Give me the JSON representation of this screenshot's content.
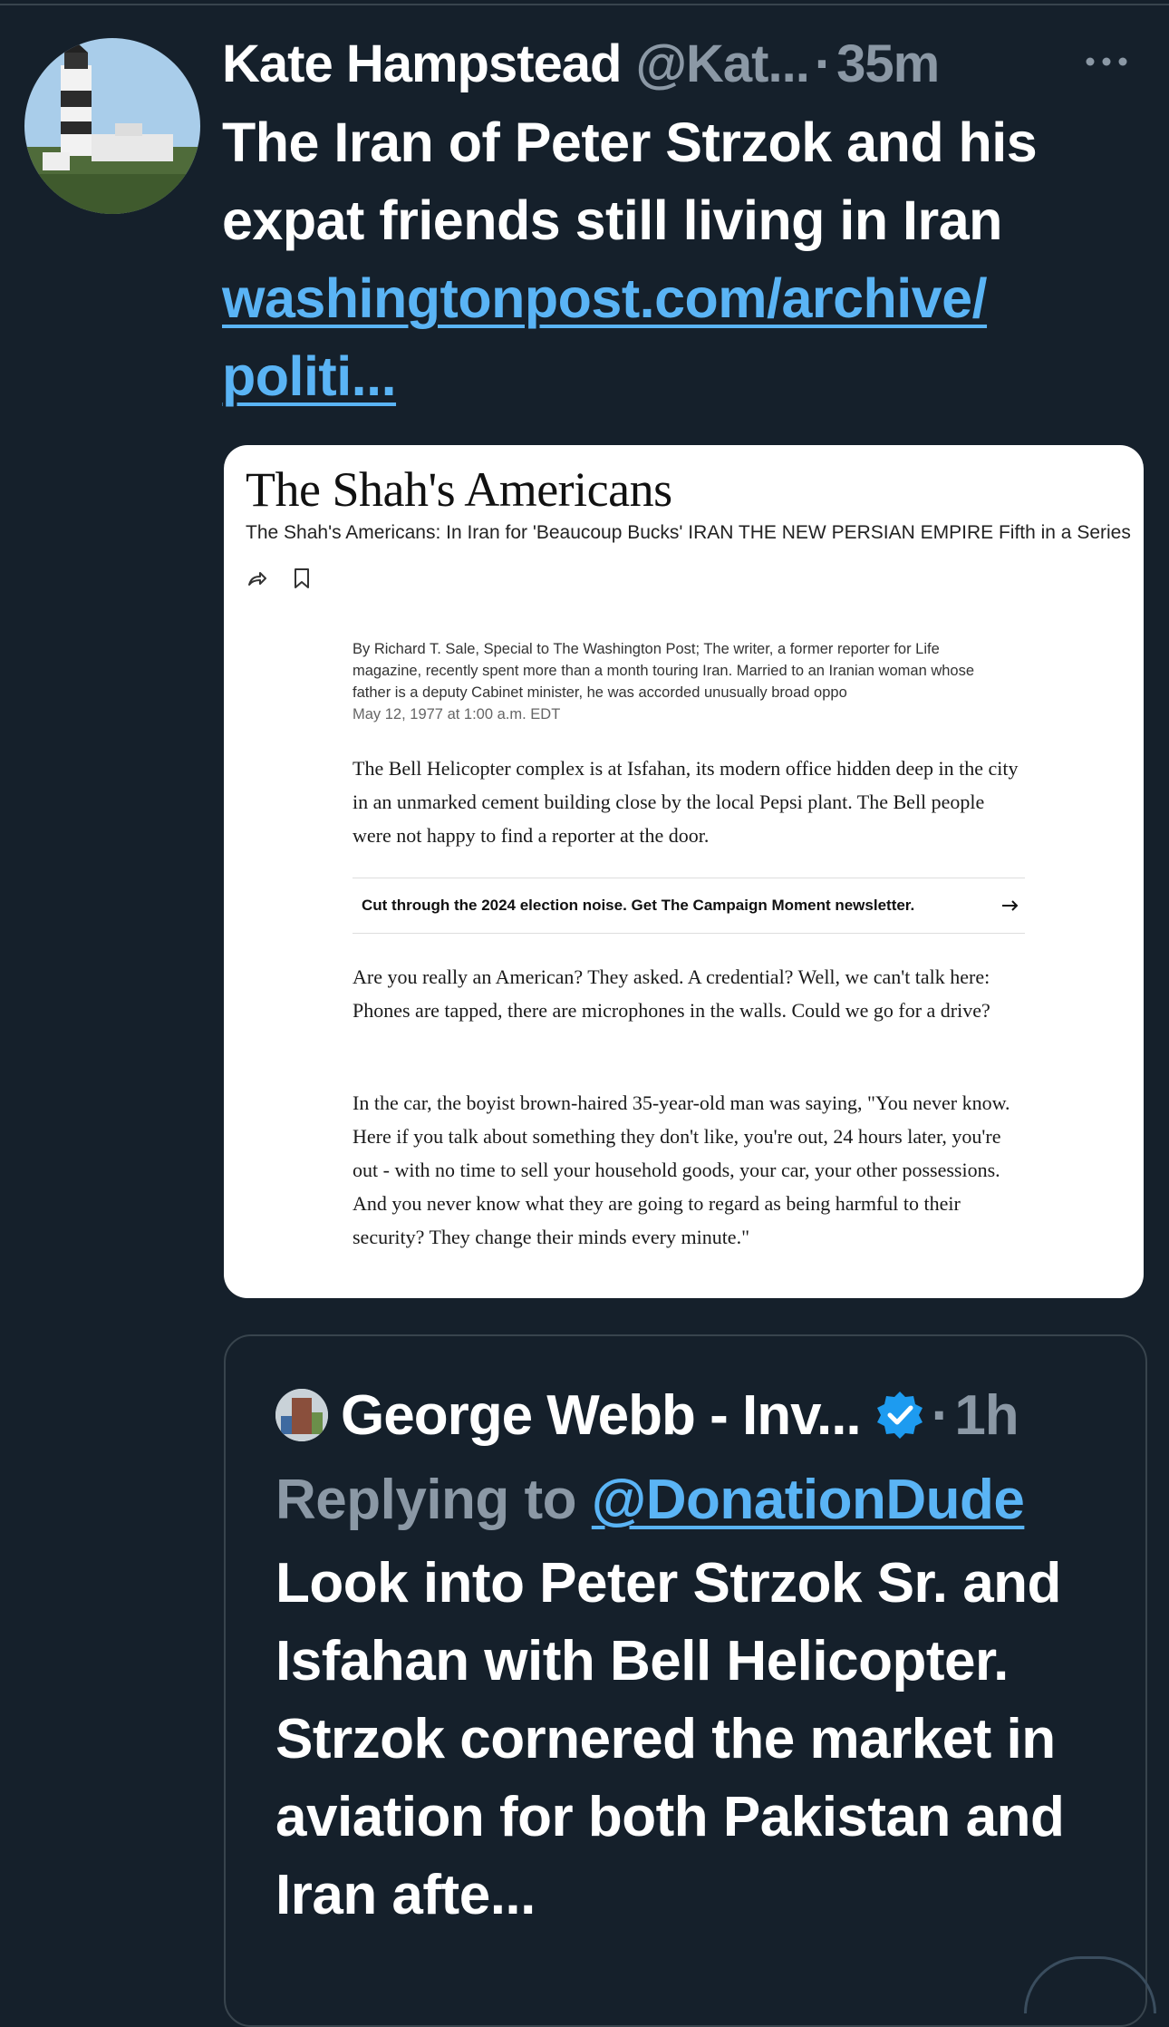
{
  "tweet": {
    "author_name": "Kate Hampstead",
    "author_handle": "@Kat...",
    "separator": "·",
    "time": "35m",
    "text": "The Iran of Peter Strzok and his expat friends still living in Iran",
    "link_line1": "washingtonpost.com/archive/",
    "link_line2": "politi..."
  },
  "card": {
    "title": "The Shah's Americans",
    "subtitle": "The Shah's Americans: In Iran for 'Beaucoup Bucks' IRAN THE NEW PERSIAN EMPIRE Fifth in a Series",
    "byline": "By Richard T. Sale, Special to The Washington Post; The writer, a former reporter for Life magazine, recently spent more than a month touring Iran. Married to an Iranian woman whose father is a deputy Cabinet minister, he was accorded unusually broad oppo",
    "dateline": "May 12, 1977 at 1:00 a.m. EDT",
    "paragraph1": "The Bell Helicopter complex is at Isfahan, its modern office hidden deep in the city in an unmarked cement building close by the local Pepsi plant. The Bell people were not happy to find a reporter at the door.",
    "newsletter": "Cut through the 2024 election noise. Get The Campaign Moment newsletter.",
    "paragraph2": "Are you really an American? They asked. A credential? Well, we can't talk here: Phones are tapped, there are microphones in the walls. Could we go for a drive?",
    "paragraph3": "In the car, the boyist brown-haired 35-year-old man was saying, \"You never know. Here if you talk about something they don't like, you're out, 24 hours later, you're out - with no time to sell your household goods, your car, your other possessions. And you never know what they are going to regard as being harmful to their security? They change their minds every minute.\""
  },
  "quote": {
    "author_name": "George Webb - Inv...",
    "separator": "·",
    "time": "1h",
    "reply_prefix": "Replying to",
    "reply_handle": "@DonationDude",
    "text": "Look into Peter Strzok Sr. and Isfahan with Bell Helicopter.  Strzok cornered the market in aviation for both Pakistan and Iran afte..."
  },
  "icons": {
    "more": "more-horizontal-icon",
    "share": "share-icon",
    "bookmark": "bookmark-icon",
    "arrow": "arrow-right-icon",
    "verified": "verified-badge-icon"
  },
  "colors": {
    "background": "#15202b",
    "link": "#5ab4f5",
    "muted": "#8b98a5",
    "verified": "#1d9bf0"
  }
}
